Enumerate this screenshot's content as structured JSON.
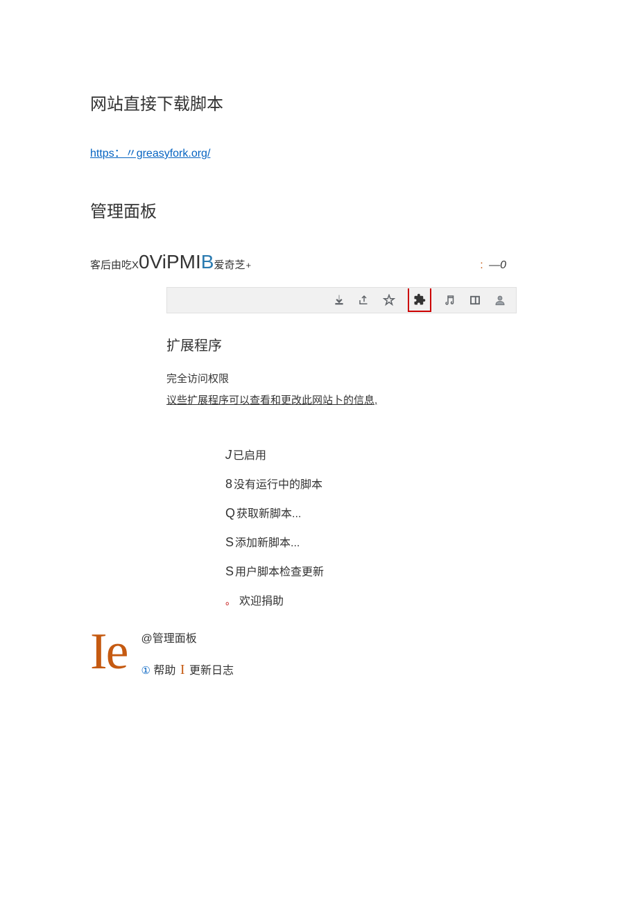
{
  "heading1": "网站直接下载脚本",
  "url": "https：〃greasyfork.org/",
  "heading2": "管理面板",
  "tabLine": {
    "prefix": "客后由吃X",
    "big1": "0ViPMI",
    "bigBlue": "B",
    "suffix": "爱奇芝",
    "plus": "+",
    "rightColon": ":",
    "rightUnder": "            ",
    "rightEnd": "—0"
  },
  "ext": {
    "title": "扩展程序",
    "subtitle": "完全访问权限",
    "note": "议些扩展程序可以查看和更改此网站卜的信息,"
  },
  "menu": {
    "item1Prefix": "J",
    "item1": "已启用",
    "item2Prefix": "8",
    "item2": "没有运行中的脚本",
    "item3Prefix": "Q",
    "item3": "获取新脚本...",
    "item4Prefix": "S",
    "item4": "添加新脚本...",
    "item5Prefix": "S",
    "item5": "用户脚本检查更新",
    "item6Dot": "。",
    "item6": "欢迎捐助"
  },
  "ieLogo": "Ie",
  "bottom": {
    "panel": "@管理面板",
    "helpCircled": "①",
    "help": "帮助",
    "sepBar": "I",
    "changelog": "更新日志"
  }
}
